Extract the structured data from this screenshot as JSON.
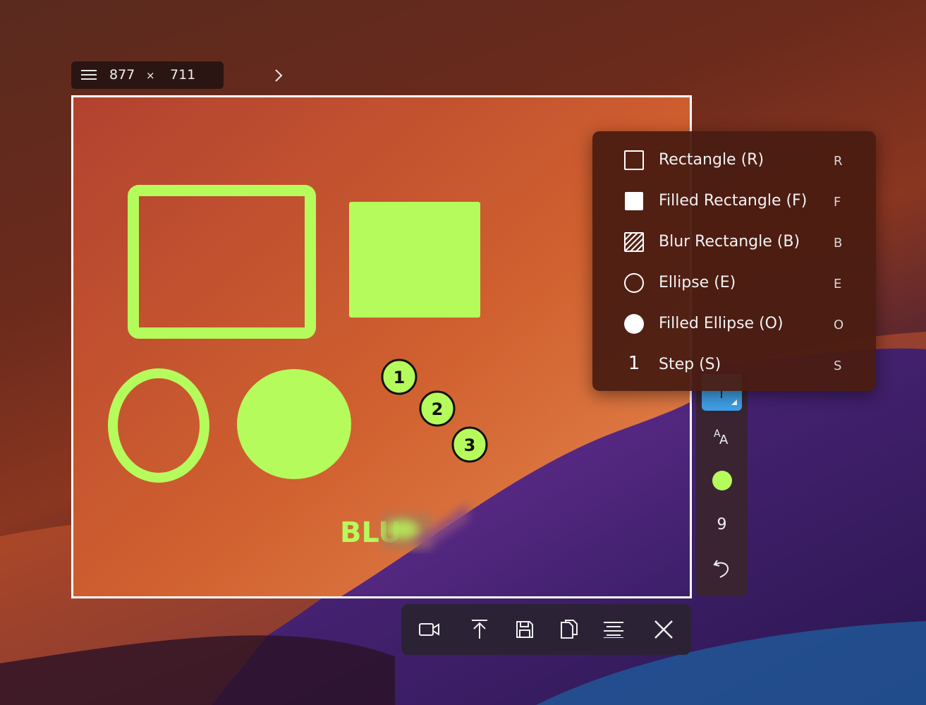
{
  "size_chip": {
    "width": "877",
    "times": "×",
    "height": "711"
  },
  "canvas": {
    "step_labels": [
      "1",
      "2",
      "3"
    ],
    "blurred_text": "BLU",
    "accent_color": "#b5fb5c"
  },
  "shape_menu": {
    "items": [
      {
        "label": "Rectangle (R)",
        "key": "R",
        "icon": "rectangle-icon"
      },
      {
        "label": "Filled Rectangle (F)",
        "key": "F",
        "icon": "filled-rectangle-icon"
      },
      {
        "label": "Blur Rectangle (B)",
        "key": "B",
        "icon": "blur-rectangle-icon"
      },
      {
        "label": "Ellipse (E)",
        "key": "E",
        "icon": "ellipse-icon"
      },
      {
        "label": "Filled Ellipse (O)",
        "key": "O",
        "icon": "filled-ellipse-icon"
      },
      {
        "label": "Step (S)",
        "key": "S",
        "icon": "step-icon",
        "icon_text": "1"
      }
    ]
  },
  "side_toolbar": {
    "font_size_icon": "font-size-icon",
    "color": "#b5fb5c",
    "stroke_width": "9",
    "undo_icon": "undo-icon"
  },
  "bottom_toolbar": {
    "buttons": [
      "record-video-icon",
      "upload-icon",
      "save-icon",
      "copy-icon",
      "ocr-text-icon",
      "close-icon"
    ]
  }
}
